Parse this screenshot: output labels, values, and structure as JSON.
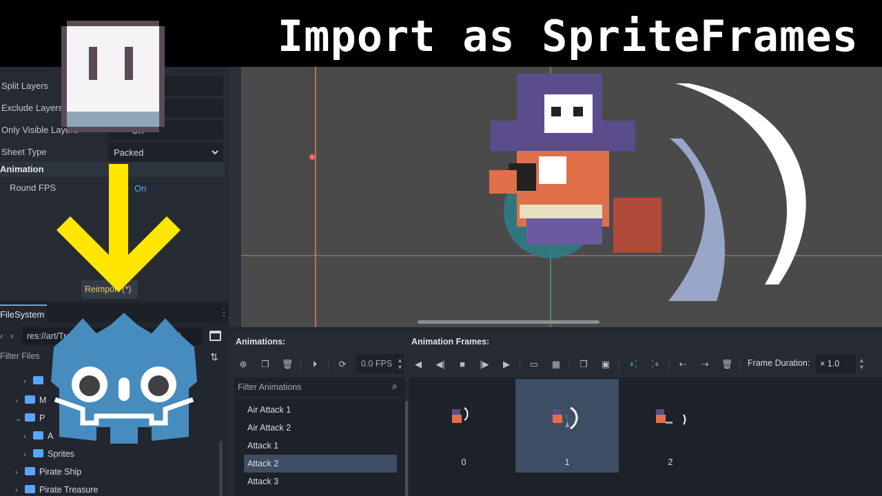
{
  "banner": {
    "title": "Import as SpriteFrames"
  },
  "inspector": {
    "rows": [
      {
        "label": "Split Layers",
        "value": ""
      },
      {
        "label": "Exclude Layers",
        "value": ""
      },
      {
        "label": "Only Visible Layers",
        "value": "On"
      },
      {
        "label": "Sheet Type",
        "value": "Packed"
      }
    ],
    "section": "Animation",
    "round_fps_label": "Round FPS",
    "round_fps_value": "On",
    "reimport_label": "Reimport (*)"
  },
  "filesystem": {
    "tab": "FileSystem",
    "path": "res://art/Treasure Hunters/Crabby Crew/",
    "filter_placeholder": "Filter Files",
    "tree": [
      "M",
      "P",
      "A",
      "Sprites",
      "Pirate Ship",
      "Pirate Treasure"
    ]
  },
  "animations": {
    "heading": "Animations:",
    "filter_placeholder": "Filter Animations",
    "items": [
      "Air Attack 1",
      "Air Attack 2",
      "Attack 1",
      "Attack 2",
      "Attack 3"
    ],
    "selected_index": 3
  },
  "frames": {
    "heading": "Animation Frames:",
    "fps": "0.0 FPS",
    "duration_label": "Frame Duration:",
    "duration_value": "× 1.0",
    "items": [
      "0",
      "1",
      "2"
    ],
    "selected_index": 1
  },
  "colors": {
    "accent": "#5aa6ff",
    "selected_bg": "#3d4d63",
    "arrow_yellow": "#ffe600",
    "godot_blue": "#478cbf"
  }
}
